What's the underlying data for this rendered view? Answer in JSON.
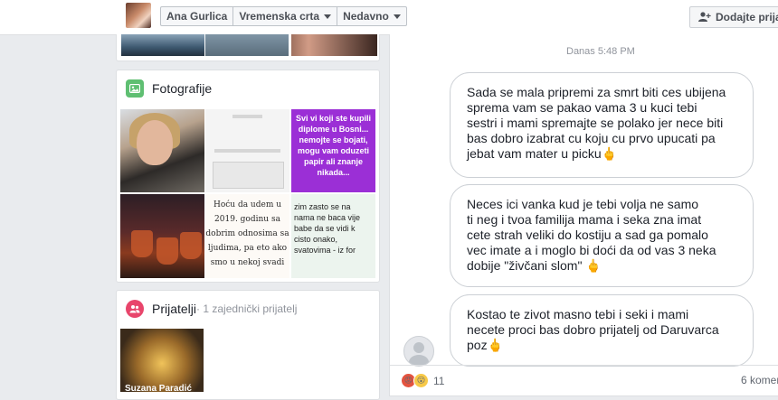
{
  "header": {
    "profile_name": "Ana Gurlica",
    "timeline_label": "Vremenska crta",
    "recent_label": "Nedavno",
    "add_friend_label": "Dodajte prijate"
  },
  "sidebar": {
    "photos": {
      "title": "Fotografije",
      "tiles": [
        {
          "text": ""
        },
        {
          "text": ""
        },
        {
          "text": "Svi vi koji ste kupili diplome u Bosni... nemojte se bojati, mogu vam oduzeti papir ali znanje nikada..."
        },
        {
          "text": ""
        },
        {
          "text": "Hoću da udem u 2019. godinu sa dobrim odnosima sa ljudima, pa eto ako smo u nekoj svadi"
        },
        {
          "text": "zim zasto se na nama ne baca vije babe da se vidi k cisto onako, svatovima - iz for"
        }
      ]
    },
    "friends": {
      "title": "Prijatelji",
      "subtitle": " · 1 zajednički prijatelj",
      "friend_name": "Suzana Paradić"
    }
  },
  "post": {
    "timestamp": "Danas 5:48 PM",
    "messages": [
      "Sada se mala pripremi za smrt biti ces ubijena\nsprema vam se pakao vama 3 u kuci tebi\nsestri i mami spremajte se polako jer nece biti\nbas dobro izabrat cu koju cu prvo upucati pa\njebat vam mater u picku🖕",
      "Neces ici vanka kud je tebi volja ne samo\nti neg i tvoa familija mama i seka zna imat\ncete strah veliki do kostiju a sad ga pomalo\nvec imate a i moglo bi doći da od vas 3 neka\ndobije \"živčani slom\" 🖕",
      "Kostao te zivot masno tebi i seki i mami\nnecete proci bas dobro prijatelj od Daruvarca\npoz🖕"
    ],
    "reaction_count": "11",
    "comments_label": "6 komen"
  },
  "colors": {
    "background": "#e9ebee",
    "card": "#ffffff",
    "photos_icon": "#5fbf72",
    "friends_icon": "#e8456b",
    "purple_tile": "#9b2fd6"
  },
  "icons": [
    "add-friend-icon",
    "photos-icon",
    "friends-icon",
    "angry-reaction-icon",
    "wow-reaction-icon"
  ]
}
